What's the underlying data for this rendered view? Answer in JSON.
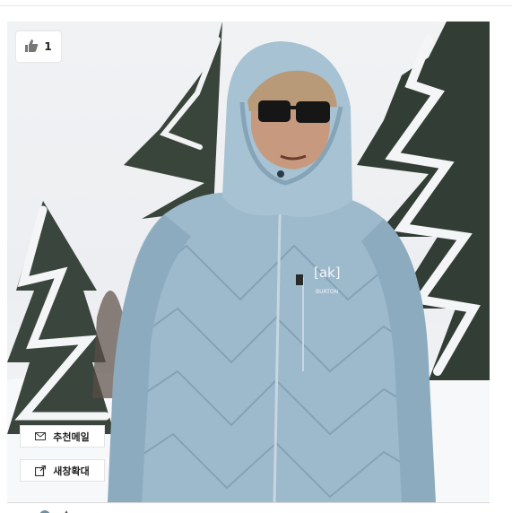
{
  "photo": {
    "alt_subject": "",
    "like_count": "1",
    "jacket_logo_text": "[ak]",
    "jacket_brand_text": "BURTON"
  },
  "buttons": {
    "recommend_mail_label": "추천메일",
    "open_new_window_label": "새창확대"
  },
  "icons": {
    "like": "thumbs-up-icon",
    "mail": "envelope-icon",
    "new_window": "external-link-icon"
  },
  "colors": {
    "jacket": "#9db9cc",
    "snow_bg": "#eef0f3",
    "tree": "#2f3a33",
    "button_bg": "#ffffff",
    "text": "#222222"
  }
}
